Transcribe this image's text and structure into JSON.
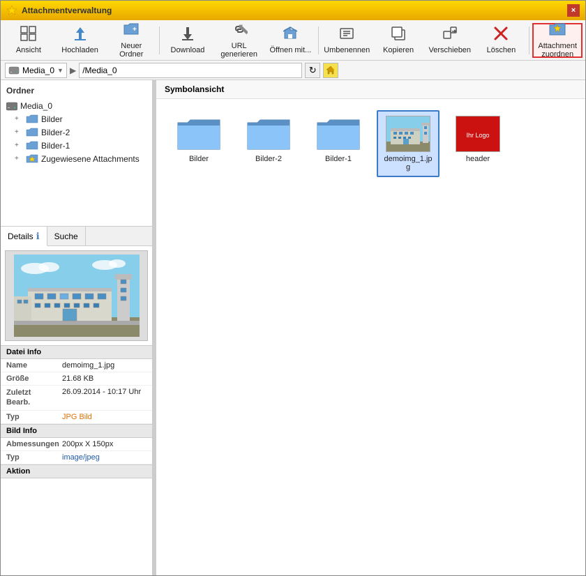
{
  "window": {
    "title": "Attachmentverwaltung",
    "close_label": "×"
  },
  "toolbar": {
    "buttons": [
      {
        "id": "ansicht",
        "label": "Ansicht",
        "icon": "⊞"
      },
      {
        "id": "hochladen",
        "label": "Hochladen",
        "icon": "⬆"
      },
      {
        "id": "neuer-ordner",
        "label": "Neuer Ordner",
        "icon": "📁+"
      },
      {
        "id": "download",
        "label": "Download",
        "icon": "⬇"
      },
      {
        "id": "url-generieren",
        "label": "URL generieren",
        "icon": "🔗"
      },
      {
        "id": "oeffnen-mit",
        "label": "Öffnen mit...",
        "icon": "📂"
      },
      {
        "id": "umbenennen",
        "label": "Umbenennen",
        "icon": "✎"
      },
      {
        "id": "kopieren",
        "label": "Kopieren",
        "icon": "⧉"
      },
      {
        "id": "verschieben",
        "label": "Verschieben",
        "icon": "➜"
      },
      {
        "id": "loeschen",
        "label": "Löschen",
        "icon": "✖"
      },
      {
        "id": "attachment-zuordnen",
        "label": "Attachment zuordnen",
        "icon": "📎",
        "active": true
      }
    ]
  },
  "pathbar": {
    "drive": "Media_0",
    "path": "/Media_0",
    "refresh_title": "Aktualisieren",
    "home_title": "Home"
  },
  "sidebar": {
    "folder_header": "Ordner",
    "tree": [
      {
        "id": "media0",
        "label": "Media_0",
        "icon": "💾",
        "level": 0,
        "expander": ""
      },
      {
        "id": "bilder",
        "label": "Bilder",
        "icon": "📁",
        "level": 1,
        "expander": "+"
      },
      {
        "id": "bilder2",
        "label": "Bilder-2",
        "icon": "📁",
        "level": 1,
        "expander": "+"
      },
      {
        "id": "bilder1",
        "label": "Bilder-1",
        "icon": "📁",
        "level": 1,
        "expander": "+"
      },
      {
        "id": "zugewiesene",
        "label": "Zugewiesene Attachments",
        "icon": "📎",
        "level": 1,
        "expander": "+"
      }
    ]
  },
  "details": {
    "tabs": [
      {
        "id": "details",
        "label": "Details",
        "active": true
      },
      {
        "id": "suche",
        "label": "Suche"
      }
    ],
    "file_info_header": "Datei Info",
    "file_info": [
      {
        "label": "Name",
        "value": "demoimg_1.jpg",
        "style": "normal"
      },
      {
        "label": "Größe",
        "value": "21.68 KB",
        "style": "normal"
      },
      {
        "label": "Zuletzt\nBearb.",
        "value": "26.09.2014 - 10:17 Uhr",
        "style": "normal"
      },
      {
        "label": "Typ",
        "value": "JPG Bild",
        "style": "orange"
      }
    ],
    "bild_info_header": "Bild Info",
    "bild_info": [
      {
        "label": "Abmessungen",
        "value": "200px X 150px",
        "style": "normal"
      },
      {
        "label": "Typ",
        "value": "image/jpeg",
        "style": "blue"
      }
    ],
    "aktion_header": "Aktion"
  },
  "iconview": {
    "header": "Symbolansicht",
    "items": [
      {
        "id": "bilder",
        "label": "Bilder",
        "type": "folder"
      },
      {
        "id": "bilder2",
        "label": "Bilder-2",
        "type": "folder"
      },
      {
        "id": "bilder1",
        "label": "Bilder-1",
        "type": "folder"
      },
      {
        "id": "demoimg1",
        "label": "demoimg_1.jpg",
        "type": "image",
        "selected": true
      },
      {
        "id": "header",
        "label": "header",
        "type": "image-red"
      }
    ]
  },
  "colors": {
    "folder_body": "#6aa0d4",
    "folder_tab": "#5288b8",
    "folder_dark": "#4a7db0",
    "selected_bg": "#4a90d9",
    "selected_border": "#2a6db8",
    "active_btn_border": "#e03030"
  }
}
